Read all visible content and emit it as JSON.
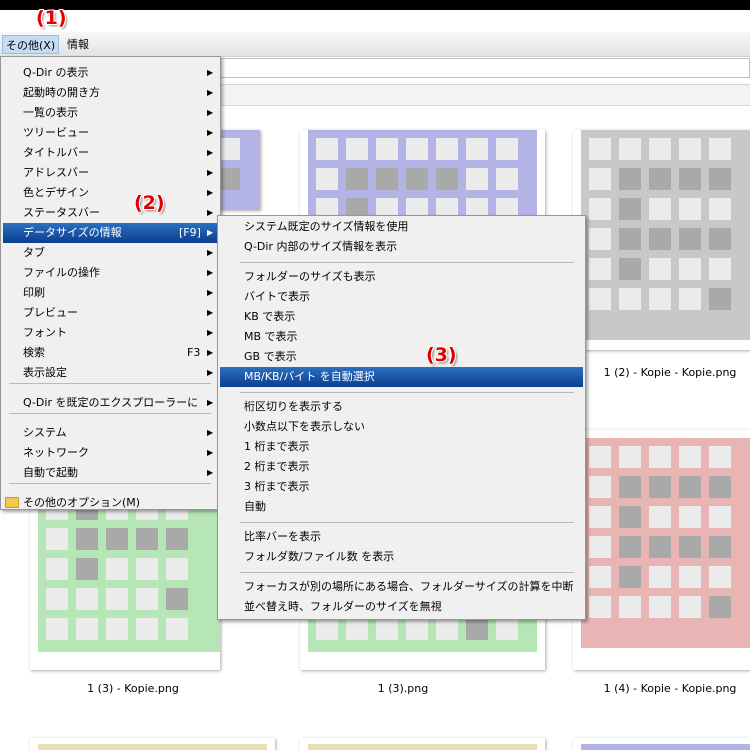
{
  "menubar": {
    "items": [
      {
        "label": "その他(X)"
      },
      {
        "label": "情報"
      }
    ]
  },
  "annotations": [
    "(1)",
    "(2)",
    "(3)"
  ],
  "main_menu": {
    "items": [
      {
        "label": "Q-Dir の表示",
        "shortcut": "",
        "submenu": true
      },
      {
        "label": "起動時の開き方",
        "shortcut": "",
        "submenu": true
      },
      {
        "label": "一覧の表示",
        "shortcut": "",
        "submenu": true
      },
      {
        "label": "ツリービュー",
        "shortcut": "",
        "submenu": true
      },
      {
        "label": "タイトルバー",
        "shortcut": "",
        "submenu": true
      },
      {
        "label": "アドレスバー",
        "shortcut": "",
        "submenu": true
      },
      {
        "label": "色とデザイン",
        "shortcut": "",
        "submenu": true
      },
      {
        "label": "ステータスバー",
        "shortcut": "",
        "submenu": true
      },
      {
        "label": "データサイズの情報",
        "shortcut": "[F9]",
        "submenu": true
      },
      {
        "label": "タブ",
        "shortcut": "",
        "submenu": true
      },
      {
        "label": "ファイルの操作",
        "shortcut": "",
        "submenu": true
      },
      {
        "label": "印刷",
        "shortcut": "",
        "submenu": true
      },
      {
        "label": "プレビュー",
        "shortcut": "",
        "submenu": true
      },
      {
        "label": "フォント",
        "shortcut": "",
        "submenu": true
      },
      {
        "label": "検索",
        "shortcut": "F3",
        "submenu": true
      },
      {
        "label": "表示設定",
        "shortcut": "",
        "submenu": true
      },
      {
        "label": "Q-Dir を既定のエクスプローラーに",
        "shortcut": "",
        "submenu": true
      },
      {
        "label": "システム",
        "shortcut": "",
        "submenu": true
      },
      {
        "label": "ネットワーク",
        "shortcut": "",
        "submenu": true
      },
      {
        "label": "自動で起動",
        "shortcut": "",
        "submenu": true
      },
      {
        "label": "その他のオプション(M)",
        "shortcut": "",
        "submenu": false
      }
    ]
  },
  "sub_menu": {
    "items": [
      {
        "label": "システム既定のサイズ情報を使用"
      },
      {
        "label": "Q-Dir 内部のサイズ情報を表示"
      },
      {
        "label": "フォルダーのサイズも表示"
      },
      {
        "label": "バイトで表示"
      },
      {
        "label": "KB で表示"
      },
      {
        "label": "MB で表示"
      },
      {
        "label": "GB で表示"
      },
      {
        "label": "MB/KB/バイト を自動選択"
      },
      {
        "label": "桁区切りを表示する"
      },
      {
        "label": "小数点以下を表示しない"
      },
      {
        "label": "1 桁まで表示"
      },
      {
        "label": "2 桁まで表示"
      },
      {
        "label": "3 桁まで表示"
      },
      {
        "label": "自動"
      },
      {
        "label": "比率バーを表示"
      },
      {
        "label": "フォルダ数/ファイル数 を表示"
      },
      {
        "label": "フォーカスが別の場所にある場合、フォルダーサイズの計算を中断"
      },
      {
        "label": "並べ替え時、フォルダーのサイズを無視"
      }
    ]
  },
  "thumbnails": [
    {
      "label": "",
      "color": "#b3b3e6"
    },
    {
      "label": "",
      "color": "#b3b3e6"
    },
    {
      "label": "1 (2) - Kopie - Kopie.png",
      "color": "#c8c8c8"
    },
    {
      "label": "",
      "color": "#b6e6b6"
    },
    {
      "label": "",
      "color": "#b6e6b6"
    },
    {
      "label": "1 (4) - Kopie - Kopie.png",
      "color": "#e8b4b4"
    },
    {
      "label": "1 (3) - Kopie.png",
      "color": ""
    },
    {
      "label": "1 (3).png",
      "color": ""
    },
    {
      "label": "",
      "color": "#e8dfb6"
    },
    {
      "label": "",
      "color": "#e8dfb6"
    },
    {
      "label": "",
      "color": "#b3b3e6"
    }
  ],
  "colors": {
    "highlight_top": "#2d6fc0",
    "highlight_bottom": "#0a3e8c",
    "annotation": "#e00000",
    "menu_bg": "#f0f0f0"
  }
}
